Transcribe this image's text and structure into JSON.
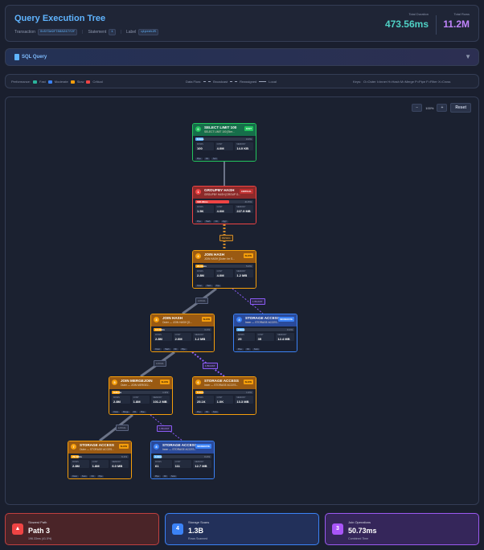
{
  "header": {
    "title": "Query Execution Tree",
    "transaction_label": "Transaction",
    "transaction_id": "0x5f3e9f7888247f2f",
    "statement_label": "Statement",
    "statement_id": "1",
    "label_label": "Label",
    "label_value": "qtpeek25",
    "total_duration_label": "Total Duration",
    "total_duration": "473.56ms",
    "total_rows_label": "Total Rows",
    "total_rows": "11.2M"
  },
  "sql": {
    "label": "SQL Query",
    "chevron": "▼"
  },
  "legend": {
    "performance_label": "Performance:",
    "perf": [
      {
        "label": "Fast",
        "color": "#2bb39b"
      },
      {
        "label": "Moderate",
        "color": "#3b82f6"
      },
      {
        "label": "Slow",
        "color": "#f59e0b"
      },
      {
        "label": "Critical",
        "color": "#ef4444"
      }
    ],
    "dataflow_label": "Data Flow:",
    "flows": [
      "Broadcast",
      "Reassigned",
      "Local"
    ],
    "keys_label": "Keys:",
    "keys": "O=Outer  I=Inner  H=Hash  M=Merge  P=Pipe  F=Filter  X=Cross"
  },
  "controls": {
    "zoom_out": "−",
    "zoom": "100%",
    "zoom_in": "+",
    "reset": "Reset"
  },
  "nodes": [
    {
      "num": "0",
      "name": "SELECT LIMIT 100",
      "sub": "SELECT LIMIT 100 [Stre...",
      "badge": "FAST",
      "time": "0.1ms",
      "pct": "0.0%",
      "pct_val": 3,
      "rows": "100",
      "cost": "4.0M",
      "memory": "14.0 KB",
      "tags": [
        "Pipe",
        "Filt",
        "Sort"
      ],
      "color": "green"
    },
    {
      "num": "1",
      "name": "GROUPBY HASH",
      "sub": "GROUPBY HASH [GROUP G...",
      "badge": "CRITICAL",
      "time": "196.33ms",
      "pct": "41.5%",
      "pct_val": 42,
      "rows": "1.5K",
      "cost": "4.0M",
      "memory": "227.9 MB",
      "tags": [
        "Pipe",
        "Hash",
        "Filt",
        "Aggr"
      ],
      "color": "red"
    },
    {
      "num": "2",
      "name": "JOIN HASH",
      "sub": "JOIN HASH [Outer: Inr S...",
      "badge": "SLOW",
      "time": "24.01ms",
      "pct": "5.0%",
      "pct_val": 5,
      "rows": "2.8M",
      "cost": "4.0M",
      "memory": "1.2 MB",
      "tags": [
        "Outer",
        "Hash",
        "Pipe"
      ],
      "color": "orange"
    },
    {
      "num": "3",
      "name": "JOIN HASH",
      "sub": "Outer — JOIN HASH [O...",
      "badge": "SLOW",
      "time": "14.00ms",
      "pct": "3.1%",
      "pct_val": 4,
      "rows": "2.8M",
      "cost": "2.0M",
      "memory": "1.2 MB",
      "tags": [
        "Outer",
        "Hash",
        "Filt",
        "Pipe"
      ],
      "color": "orange"
    },
    {
      "num": "4",
      "name": "STORAGE ACCESS",
      "sub": "Inner — STORAGE ACCES...",
      "badge": "MODERATE",
      "time": "0.2ms",
      "pct": "0.1%",
      "pct_val": 2,
      "rows": "25",
      "cost": "35",
      "memory": "12.4 MB",
      "tags": [
        "Pipe",
        "Filt",
        "Scan"
      ],
      "color": "blue"
    },
    {
      "num": "5",
      "name": "JOIN MERGEJOIN",
      "sub": "Outer — JOIN MERGEJ...",
      "badge": "SLOW",
      "time": "8.80ms",
      "pct": "1.9%",
      "pct_val": 3,
      "rows": "2.8M",
      "cost": "1.8M",
      "memory": "101.2 MB",
      "tags": [
        "Outer",
        "Merge",
        "Filt",
        "Pipe"
      ],
      "color": "orange"
    },
    {
      "num": "6",
      "name": "STORAGE ACCESS",
      "sub": "Inner — STORAGE ACCES...",
      "badge": "SLOW",
      "time": "6.2ms",
      "pct": "1.3%",
      "pct_val": 2,
      "rows": "25.1K",
      "cost": "1.0K",
      "memory": "13.3 MB",
      "tags": [
        "Pipe",
        "Filt",
        "Scan"
      ],
      "color": "orange"
    },
    {
      "num": "7",
      "name": "STORAGE ACCESS",
      "sub": "Outer — STORAGE ACCES...",
      "badge": "SLOW",
      "time": "29.02ms",
      "pct": "6.1%",
      "pct_val": 6,
      "rows": "2.8M",
      "cost": "1.8M",
      "memory": "6.0 MB",
      "tags": [
        "Outer",
        "Scan",
        "Filt",
        "Pipe"
      ],
      "color": "orange"
    },
    {
      "num": "8",
      "name": "STORAGE ACCESS",
      "sub": "Inner — STORAGE ACCES...",
      "badge": "MODERATE",
      "time": "1.2ms",
      "pct": "0.2%",
      "pct_val": 2,
      "rows": "61",
      "cost": "111",
      "memory": "12.7 MB",
      "tags": [
        "Pipe",
        "Filt",
        "Scan"
      ],
      "color": "blue"
    }
  ],
  "metric_labels": {
    "rows": "ROWS",
    "cost": "COST",
    "memory": "MEMORY",
    "ops": "OPERATIONS"
  },
  "edge_labels": [
    "RESEG",
    "1 BCAST",
    "1 BCAST",
    "1 BCAST",
    "1 BCAST"
  ],
  "edge_labels_local": [
    "LOCAL",
    "LOCAL",
    "LOCAL"
  ],
  "summary": {
    "slowest": {
      "title": "Slowest Path",
      "value": "Path 3",
      "sub": "196.33ms (41.5%)",
      "icon": "warning-icon"
    },
    "scans": {
      "title": "Storage Scans",
      "value": "1.3B",
      "sub": "Rows Scanned",
      "badge": "4"
    },
    "joins": {
      "title": "Join Operations",
      "value": "50.73ms",
      "sub": "Combined Time",
      "badge": "3"
    }
  }
}
